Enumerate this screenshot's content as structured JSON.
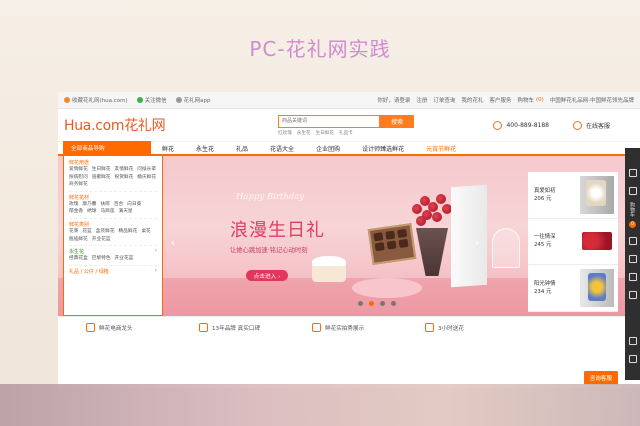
{
  "slide": {
    "title": "PC-花礼网实践"
  },
  "topbar": {
    "favorite": "收藏花礼网(hua.com)",
    "wechat": "关注微信",
    "app": "花礼网app",
    "login": "你好，请登录",
    "register": "注册",
    "order_query": "订单查询",
    "my_hualiwang": "我的花礼",
    "customer_service": "客户服务",
    "cart_label": "购物车",
    "cart_count": "(0)",
    "slogan": "中国鲜花礼品网·中国鲜花领先品牌"
  },
  "header": {
    "logo": "Hua.com花礼网",
    "search_placeholder": "商品关键词",
    "search_button": "搜索",
    "hot_words": [
      "红玫瑰",
      "永生花",
      "生日鲜花",
      "礼品卡"
    ],
    "phone": "400-889-8188",
    "online_service": "在线客服"
  },
  "nav": {
    "category_label": "全部商品导购",
    "links": [
      "鲜花",
      "永生花",
      "礼品",
      "花语大全",
      "企业团购",
      "设计师臻选鲜花",
      "元宵节鲜花"
    ]
  },
  "categories": [
    {
      "title": "鲜花用途",
      "color": "orange",
      "items": [
        "爱情鲜花",
        "生日鲜花",
        "友情鲜花",
        "问候长辈",
        "探病慰问",
        "道歉鲜花",
        "祝贺鲜花",
        "婚庆鲜花",
        "商务鲜花"
      ]
    },
    {
      "title": "鲜花花材",
      "color": "orange",
      "items": [
        "玫瑰",
        "康乃馨",
        "扶郎",
        "百合",
        "向日葵",
        "郁金香",
        "绣球",
        "马蹄莲",
        "满天星"
      ]
    },
    {
      "title": "鲜花类别",
      "color": "orange",
      "items": [
        "花束",
        "花篮",
        "盒装鲜花",
        "精品鲜花",
        "桌花",
        "瓶插鲜花",
        "开业花篮"
      ]
    },
    {
      "title": "永生花",
      "color": "green",
      "items": [
        "经典花盒",
        "巴黎特色",
        "开业花篮"
      ]
    },
    {
      "title": "礼品 / 公仔 / 绿植",
      "color": "orange",
      "items": []
    }
  ],
  "banner": {
    "script": "Happy Birthday",
    "headline": "浪漫生日礼",
    "subline": "让她心跳加速·铭记心动时刻",
    "cta": "点击进入 ›",
    "prev_arrow": "‹",
    "next_arrow": "›",
    "dot_count": 4,
    "active_dot": 1
  },
  "side_products": [
    {
      "name": "真爱如初",
      "price": "206 元"
    },
    {
      "name": "一往情深",
      "price": "245 元"
    },
    {
      "name": "阳光钟情",
      "price": "234 元"
    }
  ],
  "features": [
    "鲜花电商龙头",
    "13年品牌 真实口碑",
    "鲜花实拍秀展示",
    "3小时送花"
  ],
  "consult_button": "咨询客服",
  "right_bar": {
    "cart_label": "购物车",
    "badge": "0"
  },
  "colors": {
    "brand": "#ff6a00",
    "headline": "#e03c63",
    "slide_title": "#d08bd2"
  }
}
